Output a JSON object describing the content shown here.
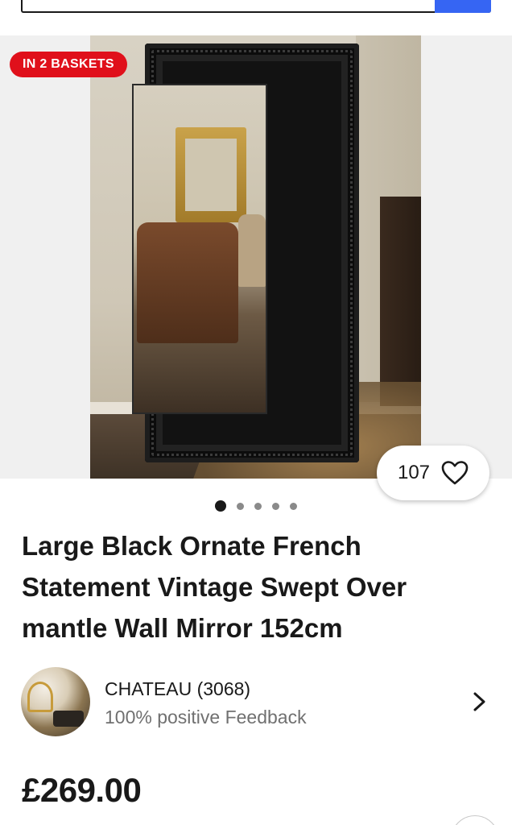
{
  "header": {
    "search_bar": "search-bar",
    "search_button_color": "#3665f3"
  },
  "gallery": {
    "badge": "IN 2 BASKETS",
    "badge_color": "#e0101b",
    "watch_count": "107",
    "watch_icon": "heart-icon",
    "image_count": 5,
    "active_index": 0
  },
  "listing": {
    "title": "Large Black Ornate French Statement Vintage Swept Over mantle Wall Mirror 152cm",
    "price": "£269.00"
  },
  "seller": {
    "name": "CHATEAU (3068)",
    "feedback": "100% positive Feedback",
    "chevron_icon": "chevron-right-icon"
  }
}
